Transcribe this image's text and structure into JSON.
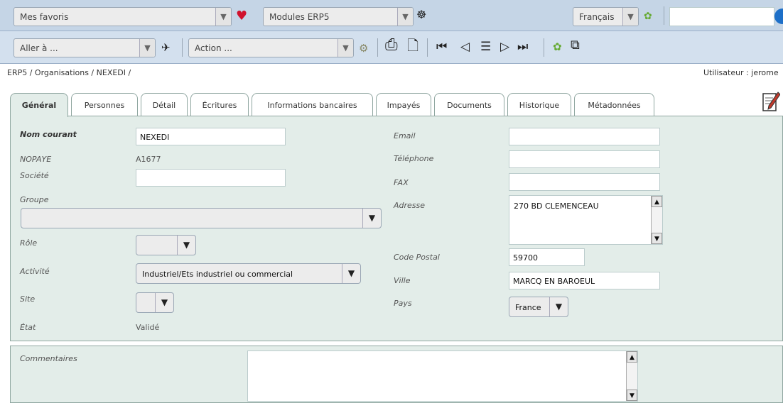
{
  "toolbar1": {
    "favorites": "Mes favoris",
    "modules": "Modules ERP5",
    "language": "Français",
    "search_value": ""
  },
  "toolbar2": {
    "goto": "Aller à ...",
    "action": "Action ..."
  },
  "breadcrumb": "ERP5 / Organisations / NEXEDI /",
  "user": "Utilisateur : jerome",
  "tabs": [
    {
      "label": "Général"
    },
    {
      "label": "Personnes"
    },
    {
      "label": "Détail"
    },
    {
      "label": "Écritures"
    },
    {
      "label": "Informations bancaires"
    },
    {
      "label": "Impayés"
    },
    {
      "label": "Documents"
    },
    {
      "label": "Historique"
    },
    {
      "label": "Métadonnées"
    }
  ],
  "form": {
    "nom_label": "Nom courant",
    "nom_value": "NEXEDI",
    "nopaye_label": "NOPAYE",
    "nopaye_value": "A1677",
    "societe_label": "Société",
    "societe_value": "",
    "groupe_label": "Groupe",
    "groupe_value": "",
    "role_label": "Rôle",
    "role_value": "",
    "activite_label": "Activité",
    "activite_value": "Industriel/Ets industriel ou commercial",
    "site_label": "Site",
    "site_value": "",
    "etat_label": "État",
    "etat_value": "Validé",
    "email_label": "Email",
    "email_value": "",
    "tel_label": "Téléphone",
    "tel_value": "",
    "fax_label": "FAX",
    "fax_value": "",
    "adresse_label": "Adresse",
    "adresse_value": "270 BD CLEMENCEAU",
    "cp_label": "Code Postal",
    "cp_value": "59700",
    "ville_label": "Ville",
    "ville_value": "MARCQ EN BAROEUL",
    "pays_label": "Pays",
    "pays_value": "France",
    "commentaires_label": "Commentaires",
    "commentaires_value": ""
  },
  "icons": {
    "favorite": "heart-icon",
    "modules": "palette-icon",
    "go": "plane-icon",
    "action": "gear-icon",
    "print": "printer-icon",
    "new": "new-document-icon",
    "first": "first-icon",
    "previous": "previous-icon",
    "list": "list-icon",
    "next": "next-icon",
    "last": "last-icon",
    "edit": "edit-document-icon"
  },
  "colors": {
    "toolbar": "#c5d5e6",
    "panel": "#e3ede9",
    "heart": "#d0122d"
  }
}
